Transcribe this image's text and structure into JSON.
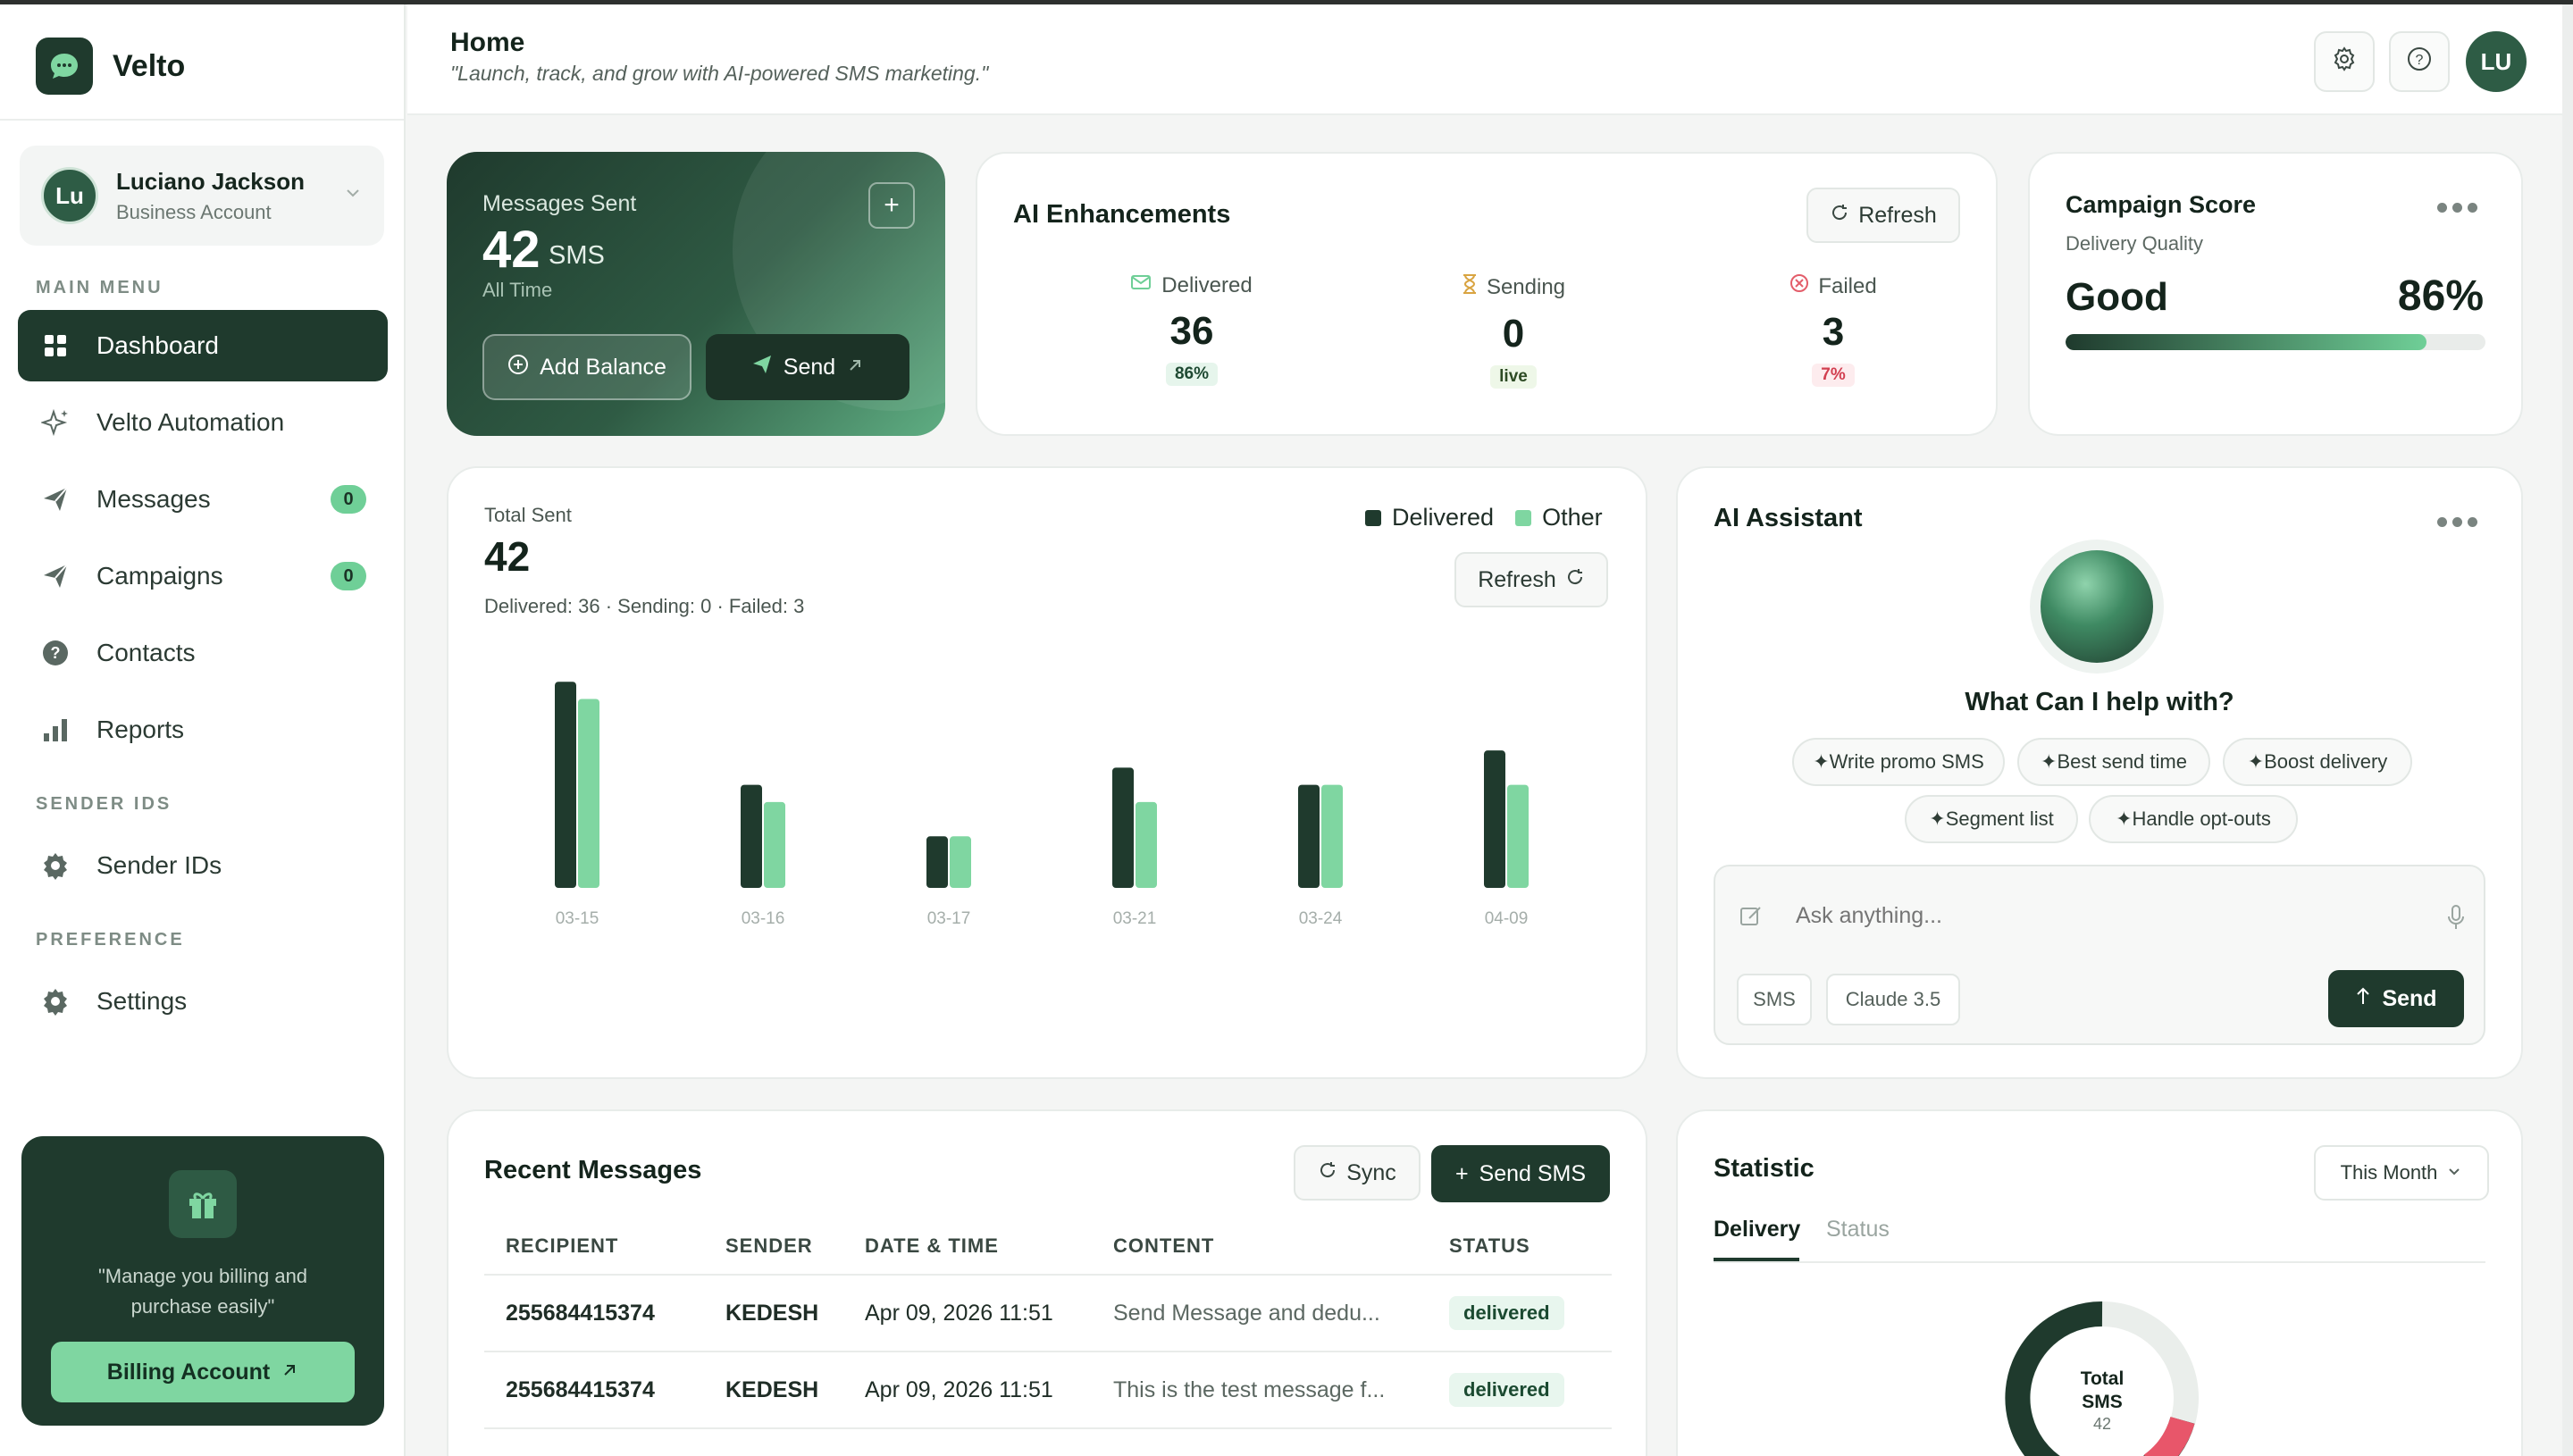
{
  "brand": {
    "name": "Velto"
  },
  "account": {
    "initials": "Lu",
    "name": "Luciano Jackson",
    "type": "Business Account"
  },
  "nav": {
    "main_label": "MAIN MENU",
    "sender_label": "SENDER IDS",
    "preference_label": "PREFERENCE",
    "items": [
      {
        "label": "Dashboard",
        "icon": "grid-icon"
      },
      {
        "label": "Velto Automation",
        "icon": "sparkle-icon"
      },
      {
        "label": "Messages",
        "icon": "send-icon",
        "badge": "0"
      },
      {
        "label": "Campaigns",
        "icon": "send-icon",
        "badge": "0"
      },
      {
        "label": "Contacts",
        "icon": "help-circle-icon"
      },
      {
        "label": "Reports",
        "icon": "bar-chart-icon"
      },
      {
        "label": "Sender IDs",
        "icon": "gear-icon"
      },
      {
        "label": "Settings",
        "icon": "gear-icon"
      }
    ]
  },
  "promo": {
    "text": "\"Manage you billing and purchase easily\"",
    "button": "Billing Account"
  },
  "header": {
    "title": "Home",
    "subtitle": "\"Launch, track, and grow with AI-powered SMS marketing.\"",
    "avatar": "LU"
  },
  "messages_card": {
    "label": "Messages Sent",
    "value": "42",
    "unit": "SMS",
    "period": "All Time",
    "add_balance": "Add Balance",
    "send": "Send"
  },
  "ai_enhancements": {
    "title": "AI Enhancements",
    "refresh": "Refresh",
    "stats": [
      {
        "label": "Delivered",
        "value": "36",
        "tag": "86%"
      },
      {
        "label": "Sending",
        "value": "0",
        "tag": "live"
      },
      {
        "label": "Failed",
        "value": "3",
        "tag": "7%"
      }
    ]
  },
  "campaign_score": {
    "title": "Campaign Score",
    "subtitle": "Delivery Quality",
    "rating": "Good",
    "percent_text": "86%",
    "percent": 86
  },
  "chart": {
    "label": "Total Sent",
    "total": "42",
    "summary": "Delivered: 36 · Sending: 0 · Failed: 3",
    "refresh": "Refresh",
    "legend": [
      "Delivered",
      "Other"
    ]
  },
  "chart_data": {
    "type": "bar",
    "categories": [
      "03-15",
      "03-16",
      "03-17",
      "03-21",
      "03-24",
      "04-09"
    ],
    "series": [
      {
        "name": "Delivered",
        "values": [
          12,
          6,
          3,
          7,
          6,
          8
        ],
        "color": "#1f3a2d"
      },
      {
        "name": "Other",
        "values": [
          11,
          5,
          3,
          5,
          6,
          6
        ],
        "color": "#7fd6a1"
      }
    ],
    "ylim": [
      0,
      13
    ]
  },
  "assistant": {
    "title": "AI Assistant",
    "question": "What Can I help with?",
    "chips": [
      "Write promo SMS",
      "Best send time",
      "Boost delivery",
      "Segment list",
      "Handle opt-outs"
    ],
    "placeholder": "Ask anything...",
    "tag_sms": "SMS",
    "tag_model": "Claude 3.5",
    "send": "Send"
  },
  "recent": {
    "title": "Recent Messages",
    "sync": "Sync",
    "send_sms": "Send SMS",
    "columns": [
      "RECIPIENT",
      "SENDER",
      "DATE & TIME",
      "CONTENT",
      "STATUS"
    ],
    "rows": [
      {
        "recipient": "255684415374",
        "sender": "KEDESH",
        "datetime": "Apr 09, 2026 11:51",
        "content": "Send Message and dedu...",
        "status": "delivered"
      },
      {
        "recipient": "255684415374",
        "sender": "KEDESH",
        "datetime": "Apr 09, 2026 11:51",
        "content": "This is the test message f...",
        "status": "delivered"
      }
    ]
  },
  "statistic": {
    "title": "Statistic",
    "period": "This Month",
    "tabs": [
      "Delivery",
      "Status"
    ],
    "donut_label_1": "Total",
    "donut_label_2": "SMS",
    "donut_value": "42"
  }
}
